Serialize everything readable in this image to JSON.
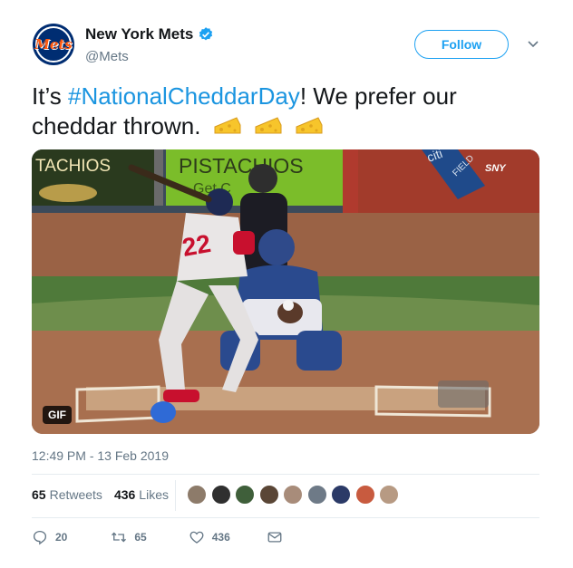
{
  "account": {
    "display_name": "New York Mets",
    "handle": "@Mets",
    "avatar_text": "Mets",
    "verified": true
  },
  "follow_button": {
    "label": "Follow"
  },
  "tweet": {
    "text_prefix": "It’s ",
    "hashtag": "#NationalCheddarDay",
    "text_suffix": "! We prefer our cheddar thrown.",
    "emoji": [
      "cheese-icon",
      "cheese-icon",
      "cheese-icon"
    ]
  },
  "media": {
    "badge": "GIF",
    "signs": {
      "left_sign": "TACHIOS",
      "center_sign": "PISTACHIOS",
      "center_sub": "Get C",
      "citi": "citi",
      "field": "FIELD",
      "sny": "SNY",
      "jersey_number": "22"
    }
  },
  "timestamp": "12:49 PM - 13 Feb 2019",
  "stats": {
    "retweets_count": "65",
    "retweets_label": "Retweets",
    "likes_count": "436",
    "likes_label": "Likes"
  },
  "actions": {
    "reply_count": "20",
    "retweet_count": "65",
    "like_count": "436"
  },
  "colors": {
    "accent": "#1da1f2",
    "hashtag": "#1b95e0",
    "muted": "#657786",
    "mets_blue": "#002d72",
    "mets_orange": "#ff5910"
  },
  "liker_avatars": [
    {
      "color": "#8d7b6a"
    },
    {
      "color": "#2f2f2f"
    },
    {
      "color": "#3f5f3a"
    },
    {
      "color": "#5a4636"
    },
    {
      "color": "#a88c7a"
    },
    {
      "color": "#6e7a87"
    },
    {
      "color": "#2b3a67"
    },
    {
      "color": "#c85b3f"
    },
    {
      "color": "#b79a83"
    }
  ]
}
